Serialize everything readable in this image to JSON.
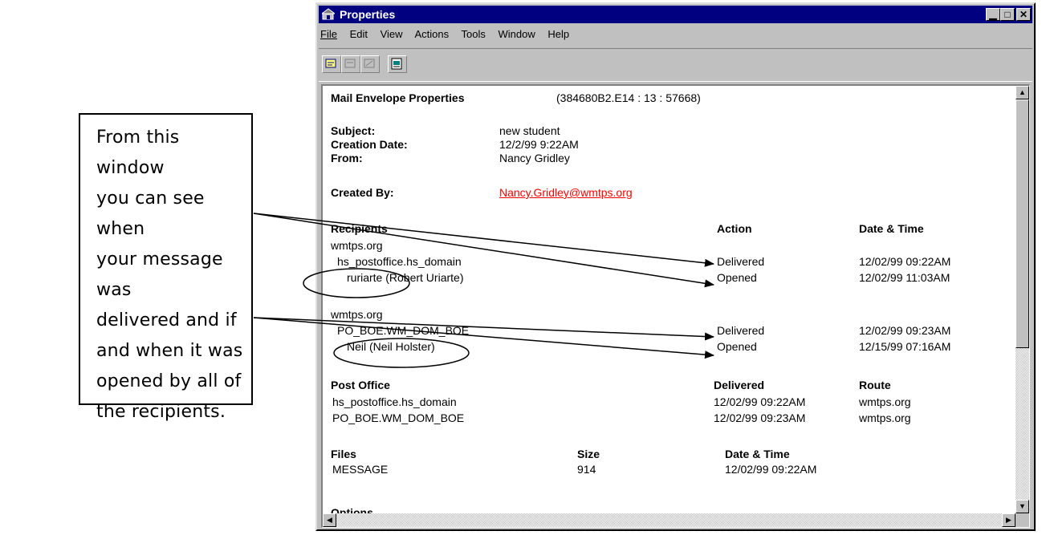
{
  "callout": {
    "text": "From this window\nyou can see when\nyour message was\ndelivered and if\nand when it was\nopened by all of\nthe recipients."
  },
  "window": {
    "title": "Properties",
    "menu": [
      "File",
      "Edit",
      "View",
      "Actions",
      "Tools",
      "Window",
      "Help"
    ],
    "toolbar_icons": [
      "properties-icon",
      "disabled-tool-icon",
      "disabled-tool-icon-2",
      "save-to-folder-icon"
    ]
  },
  "props": {
    "heading": "Mail Envelope Properties",
    "id": "(384680B2.E14 : 13 : 57668)",
    "subject_label": "Subject:",
    "subject": "new student",
    "creation_label": "Creation Date:",
    "creation": "12/2/99 9:22AM",
    "from_label": "From:",
    "from": "Nancy Gridley",
    "created_by_label": "Created By:",
    "created_by": "Nancy.Gridley@wmtps.org"
  },
  "recipients": {
    "header": "Recipients",
    "action_header": "Action",
    "datetime_header": "Date & Time",
    "groups": [
      {
        "domain": "wmtps.org",
        "postoffice": "hs_postoffice.hs_domain",
        "user": "ruriarte (Robert Uriarte)",
        "delivered_action": "Delivered",
        "delivered_time": "12/02/99 09:22AM",
        "opened_action": "Opened",
        "opened_time": "12/02/99 11:03AM"
      },
      {
        "domain": "wmtps.org",
        "postoffice": "PO_BOE.WM_DOM_BOE",
        "user": "Neil (Neil Holster)",
        "delivered_action": "Delivered",
        "delivered_time": "12/02/99 09:23AM",
        "opened_action": "Opened",
        "opened_time": "12/15/99 07:16AM"
      }
    ]
  },
  "post_office": {
    "header": "Post Office",
    "delivered_header": "Delivered",
    "route_header": "Route",
    "rows": [
      {
        "name": "hs_postoffice.hs_domain",
        "delivered": "12/02/99 09:22AM",
        "route": "wmtps.org"
      },
      {
        "name": "PO_BOE.WM_DOM_BOE",
        "delivered": "12/02/99 09:23AM",
        "route": "wmtps.org"
      }
    ]
  },
  "files": {
    "header": "Files",
    "size_header": "Size",
    "datetime_header": "Date & Time",
    "rows": [
      {
        "name": "MESSAGE",
        "size": "914",
        "datetime": "12/02/99 09:22AM"
      }
    ]
  },
  "options": {
    "header": "Options"
  },
  "colors": {
    "titlebar": "#000080",
    "link": "#ff0000",
    "window_bg": "#c0c0c0"
  }
}
